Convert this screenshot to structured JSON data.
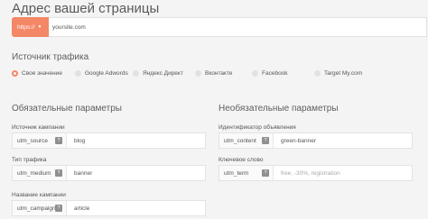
{
  "page_title": "Адрес вашей страницы",
  "url_bar": {
    "protocol": "https://",
    "url_value": "yoursite.com"
  },
  "traffic": {
    "heading": "Источник трафика",
    "options": [
      {
        "label": "Свое значение",
        "selected": true
      },
      {
        "label": "Google Adwords",
        "selected": false
      },
      {
        "label": "Яндекс Директ",
        "selected": false
      },
      {
        "label": "Вконтакте",
        "selected": false
      },
      {
        "label": "Facebook",
        "selected": false
      },
      {
        "label": "Target My.com",
        "selected": false
      }
    ]
  },
  "required": {
    "heading": "Обязательные параметры",
    "fields": [
      {
        "label": "Источник кампании",
        "key": "utm_source",
        "value": "blog",
        "placeholder": ""
      },
      {
        "label": "Тип трафика",
        "key": "utm_medium",
        "value": "banner",
        "placeholder": ""
      },
      {
        "label": "Название кампании",
        "key": "utm_campaign",
        "value": "article",
        "placeholder": ""
      }
    ]
  },
  "optional": {
    "heading": "Необязательные параметры",
    "fields": [
      {
        "label": "Идентификатор объявления",
        "key": "utm_content",
        "value": "green-banner",
        "placeholder": ""
      },
      {
        "label": "Ключевое слово",
        "key": "utm_term",
        "value": "",
        "placeholder": "free, -30%, registration"
      }
    ]
  },
  "help_icon_glyph": "?",
  "colors": {
    "accent": "#f38766"
  }
}
